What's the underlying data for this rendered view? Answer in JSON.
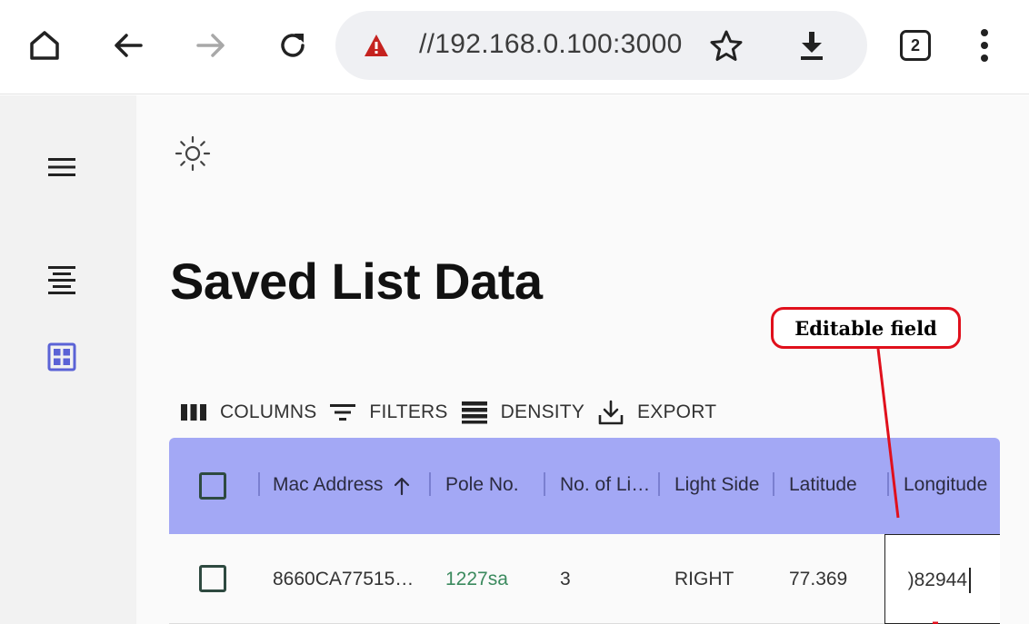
{
  "browser": {
    "url": "//192.168.0.100:3000",
    "tab_count": "2",
    "icons": [
      "home-icon",
      "back-icon",
      "forward-icon",
      "reload-icon",
      "warning-icon",
      "star-icon",
      "download-icon",
      "tab-switcher-icon",
      "kebab-menu-icon"
    ]
  },
  "sidebar": {
    "items": [
      "menu-icon",
      "list-icon",
      "grid-icon"
    ],
    "active_color": "#5b63d6"
  },
  "main": {
    "title": "Saved List Data"
  },
  "toolbar": {
    "columns_label": "COLUMNS",
    "filters_label": "FILTERS",
    "density_label": "DENSITY",
    "export_label": "EXPORT"
  },
  "grid": {
    "header_color": "#a3a8f5",
    "columns": [
      "Mac Address",
      "Pole No.",
      "No. of Li…",
      "Light Side",
      "Latitude",
      "Longitude"
    ],
    "sort": {
      "column": "Mac Address",
      "direction": "ascending"
    },
    "rows": [
      {
        "mac": "8660CA77515…",
        "pole": "1227sa",
        "lights": "3",
        "side": "RIGHT",
        "latitude": "77.369",
        "longitude": ")82944"
      }
    ]
  },
  "annotation": {
    "label": "Editable field",
    "color": "#e0101c"
  }
}
